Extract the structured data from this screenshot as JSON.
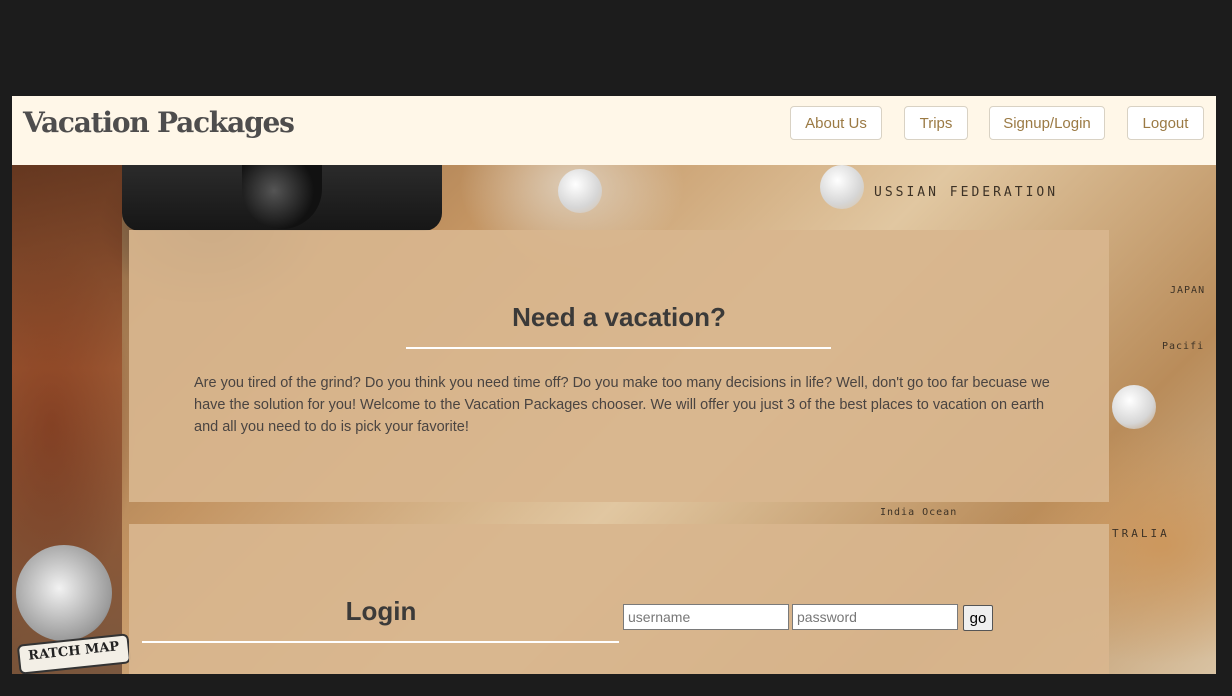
{
  "navbar": {
    "brand": "Vacation Packages",
    "links": [
      "About Us",
      "Trips",
      "Signup/Login",
      "Logout"
    ]
  },
  "background": {
    "map_labels": {
      "russia": "USSIAN FEDERATION",
      "japan": "JAPAN",
      "pacific": "Pacifi",
      "indian_ocean": "India Ocean",
      "australia": "TRALIA",
      "scratch_map": "RATCH MAP"
    }
  },
  "intro_card": {
    "heading": "Need a vacation?",
    "body": "Are you tired of the grind? Do you think you need time off? Do you make too many decisions in life? Well, don't go too far becuase we have the solution for you! Welcome to the Vacation Packages chooser. We will offer you just 3 of the best places to vacation on earth and all you need to do is pick your favorite!"
  },
  "login_card": {
    "heading": "Login",
    "username_placeholder": "username",
    "password_placeholder": "password",
    "submit_label": "go"
  },
  "colors": {
    "page_background": "#1c1c1c",
    "navbar_background": "#fff7e8",
    "card_background": "#d8b68e",
    "nav_link_text": "#9b7a44"
  }
}
